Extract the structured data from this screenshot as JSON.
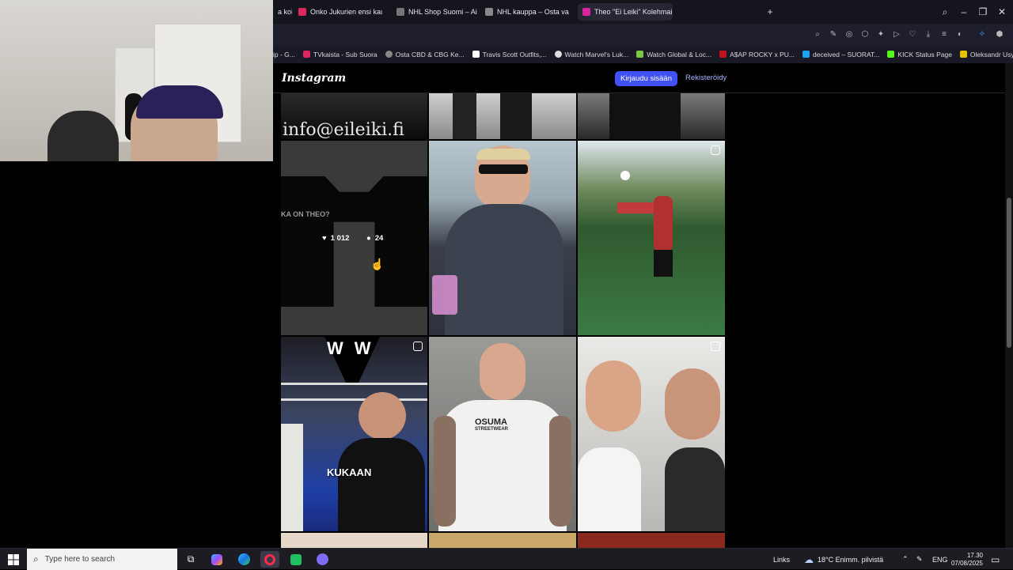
{
  "browser": {
    "tabs": [
      {
        "label": "a koi"
      },
      {
        "label": "Onko Jukurien ensi kausi j"
      },
      {
        "label": "NHL Shop Suomi – Aidot"
      },
      {
        "label": "NHL kauppa – Osta vaatt"
      },
      {
        "label": "Theo \"Ei Leiki\" Kolehmain"
      }
    ],
    "bookmarks": [
      "ip - G...",
      "TVkaista - Sub Suora",
      "Osta CBD & CBG Ke...",
      "Travis Scott Outfits,...",
      "Watch Marvel's Luk...",
      "Watch Global & Loc...",
      "A$AP ROCKY x PU...",
      "deceived – SUORAT...",
      "KICK Status Page",
      "Oleksandr Usyk vs D..."
    ]
  },
  "instagram": {
    "logo": "Instagram",
    "login_label": "Kirjaudu sisään",
    "signup_label": "Rekisteröidy",
    "hover_post": {
      "likes": "1 012",
      "comments": "24",
      "shirt_text": "KA ON THEO?"
    },
    "top_left_caption": "info@eileiki.fi",
    "boxing_caption": "KUKAAN",
    "osuma_text": "OSUMA",
    "osuma_sub": "STREETWEAR"
  },
  "taskbar": {
    "search_placeholder": "Type here to search",
    "links_label": "Links",
    "weather": "18°C  Enimm. pilvistä",
    "language": "ENG",
    "time": "17.30",
    "date": "07/08/2025"
  }
}
